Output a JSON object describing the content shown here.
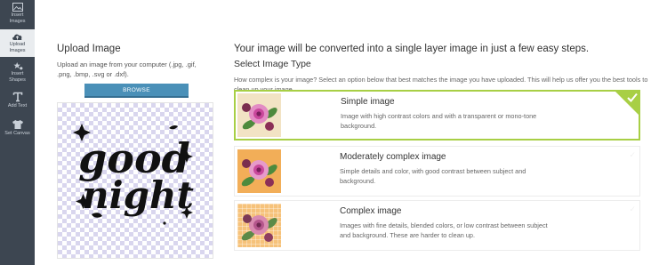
{
  "sidebar": {
    "items": [
      {
        "label_line1": "Insert",
        "label_line2": "Images",
        "icon": "image-icon"
      },
      {
        "label_line1": "Upload",
        "label_line2": "Images",
        "icon": "upload-cloud-icon",
        "active": true
      },
      {
        "label_line1": "Insert",
        "label_line2": "Shapes",
        "icon": "shapes-icon"
      },
      {
        "label_line1": "Add Text",
        "label_line2": "",
        "icon": "text-icon"
      },
      {
        "label_line1": "Set Canvas",
        "label_line2": "",
        "icon": "shirt-icon"
      }
    ]
  },
  "upload": {
    "title": "Upload Image",
    "description": "Upload an image from your computer (.jpg, .gif, .png, .bmp, .svg or .dxf).",
    "browse_label": "BROWSE",
    "preview_alt_text_line1": "good",
    "preview_alt_text_line2": "night"
  },
  "main": {
    "title": "Your image will be converted into a single layer image in just a few easy steps.",
    "subtitle": "Select Image Type",
    "intro": "How complex is your image? Select an option below that best matches the image you have uploaded. This will help us offer you the best tools to clean up your image.",
    "options": [
      {
        "title": "Simple image",
        "description": "Image with high contrast colors and with a transparent or mono-tone background.",
        "selected": true
      },
      {
        "title": "Moderately complex image",
        "description": "Simple details and color, with good contrast between subject and background.",
        "selected": false
      },
      {
        "title": "Complex image",
        "description": "Images with fine details, blended colors, or low contrast between subject and background. These are harder to clean up.",
        "selected": false
      }
    ]
  },
  "colors": {
    "sidebar_bg": "#3d4651",
    "accent_green": "#a8cf45",
    "browse_blue": "#4a90b8"
  }
}
